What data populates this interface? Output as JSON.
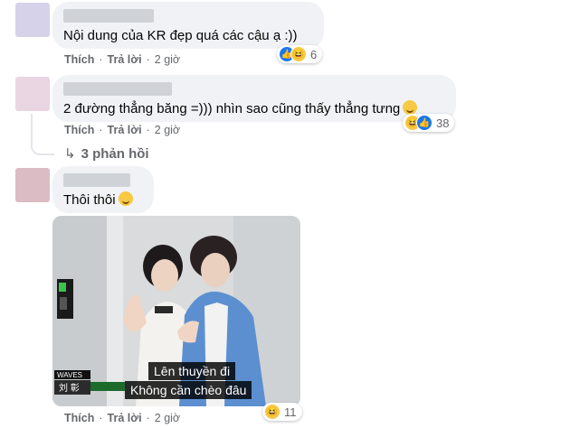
{
  "comments": [
    {
      "text": "Nội dung của KR đẹp quá các cậu ạ :))",
      "actions": {
        "like": "Thích",
        "reply": "Trả lời",
        "time": "2 giờ"
      },
      "reactions": {
        "icons": [
          "like-icon",
          "haha-icon"
        ],
        "count": "6"
      }
    },
    {
      "text": "2 đường thẳng băng =))) nhìn sao cũng thấy thẳng tưng",
      "actions": {
        "like": "Thích",
        "reply": "Trả lời",
        "time": "2 giờ"
      },
      "reactions": {
        "icons": [
          "haha-icon",
          "like-icon"
        ],
        "count": "38"
      },
      "replies_label": "3 phản hồi"
    },
    {
      "text": "Thôi thôi",
      "actions": {
        "like": "Thích",
        "reply": "Trả lời",
        "time": "2 giờ"
      },
      "reactions": {
        "icons": [
          "haha-icon"
        ],
        "count": "11"
      },
      "media": {
        "badge": "WAVES",
        "name_tag": "刘 彰",
        "subtitle_1": "Lên thuyền đi",
        "subtitle_2": "Không cần chèo đâu"
      }
    }
  ],
  "colors": {
    "bubble": "#f0f2f5",
    "meta_text": "#65676b",
    "avatar_1": "#d6d2ea",
    "avatar_2": "#ead6e2",
    "avatar_3": "#dcbcc4"
  }
}
